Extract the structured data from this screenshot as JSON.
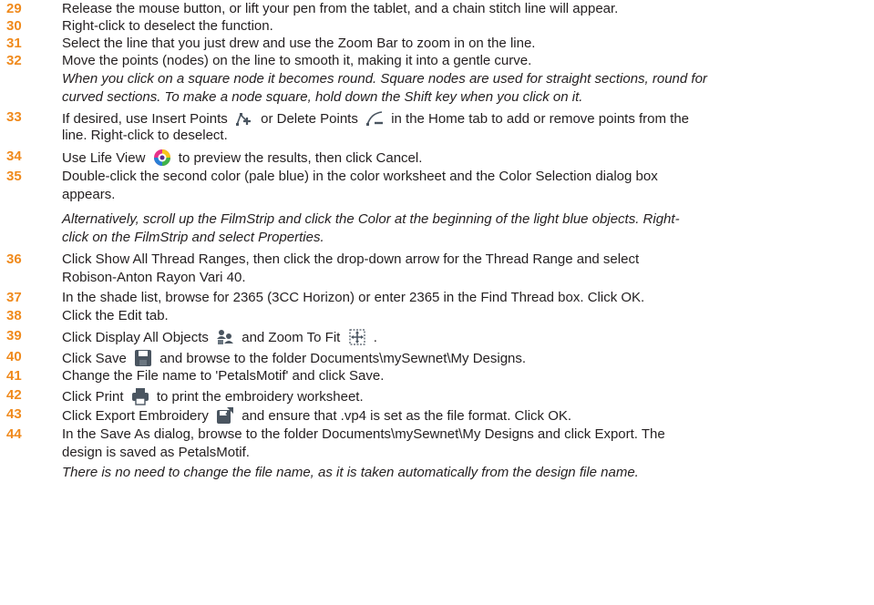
{
  "steps": [
    {
      "num": "29",
      "text": "Release the mouse button, or lift your pen from the tablet, and a chain stitch line will appear."
    },
    {
      "num": "30",
      "text": "Right-click to deselect the function."
    },
    {
      "num": "31",
      "text": "Select the line that you just drew and use the Zoom Bar to zoom in on the line."
    },
    {
      "num": "32",
      "text": "Move the points (nodes) on the line to smooth it, making it into a gentle curve.",
      "note": [
        "When you click on a square node it becomes round. Square nodes are used for straight sections, round for",
        "curved sections. To make a node square, hold down the Shift key when you click on it."
      ]
    },
    {
      "num": "33",
      "a": "If desired, use Insert Points",
      "b": "or Delete Points",
      "c": "in the Home tab to add or remove points from the",
      "line2": "line. Right-click to deselect."
    },
    {
      "num": "34",
      "a": "Use Life View",
      "b": "to preview the results, then click Cancel."
    },
    {
      "num": "35",
      "line1": "Double-click the second color (pale blue) in the color worksheet and the Color Selection dialog box",
      "line2": "appears.",
      "note": [
        "Alternatively, scroll up the FilmStrip and click the Color at the beginning of the light blue objects. Right-",
        "click on the FilmStrip and select Properties."
      ]
    },
    {
      "num": "36",
      "line1": "Click Show All Thread Ranges, then click the drop-down arrow for the Thread Range and select",
      "line2": "Robison-Anton Rayon Vari 40."
    },
    {
      "num": "37",
      "text": "In the shade list, browse for 2365 (3CC Horizon) or enter 2365 in the Find Thread box. Click OK."
    },
    {
      "num": "38",
      "text": "Click the Edit tab."
    },
    {
      "num": "39",
      "a": "Click Display All Objects",
      "b": "and Zoom To Fit",
      "c": "."
    },
    {
      "num": "40",
      "a": "Click Save",
      "b": "and browse to the folder Documents\\mySewnet\\My Designs."
    },
    {
      "num": "41",
      "text": "Change the File name to 'PetalsMotif' and click Save."
    },
    {
      "num": "42",
      "a": "Click Print",
      "b": "to print the embroidery worksheet."
    },
    {
      "num": "43",
      "a": "Click Export Embroidery",
      "b": "and ensure that .vp4 is set as the file format. Click OK."
    },
    {
      "num": "44",
      "line1": "In the Save As dialog, browse to the folder Documents\\mySewnet\\My Designs and click Export. The",
      "line2": "design is saved as PetalsMotif.",
      "note": [
        "There is no need to change the file name, as it is taken automatically from the design file name."
      ]
    }
  ],
  "icons": {
    "insert_points": "insert-points-icon",
    "delete_points": "delete-points-icon",
    "life_view": "life-view-icon",
    "display_all_objects": "display-all-objects-icon",
    "zoom_to_fit": "zoom-to-fit-icon",
    "save": "save-icon",
    "print": "print-icon",
    "export_embroidery": "export-embroidery-icon"
  },
  "colors": {
    "step_number": "#f08a1c",
    "text": "#231f20",
    "icon": "#4a5560"
  }
}
